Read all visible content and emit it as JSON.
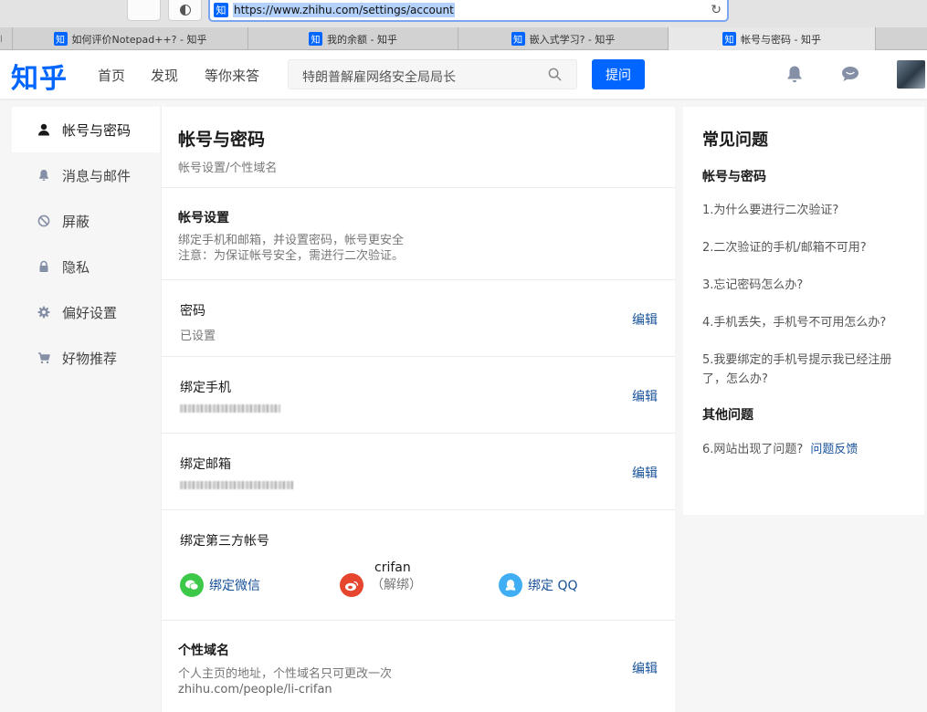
{
  "browser": {
    "url": "https://www.zhihu.com/settings/account",
    "favicon_char": "知",
    "reload_glyph": "↻",
    "tab_edge": "ꞁ",
    "tabs": [
      {
        "title": "如何评价Notepad++? - 知乎"
      },
      {
        "title": "我的余额 - 知乎"
      },
      {
        "title": "嵌入式学习? - 知乎"
      },
      {
        "title": "帐号与密码 - 知乎"
      }
    ]
  },
  "header": {
    "logo": "知乎",
    "nav": [
      "首页",
      "发现",
      "等你来答"
    ],
    "search_text": "特朗普解雇网络安全局局长",
    "ask_label": "提问"
  },
  "sidebar": {
    "items": [
      {
        "label": "帐号与密码",
        "icon": "user-icon"
      },
      {
        "label": "消息与邮件",
        "icon": "bell-icon"
      },
      {
        "label": "屏蔽",
        "icon": "block-icon"
      },
      {
        "label": "隐私",
        "icon": "lock-icon"
      },
      {
        "label": "偏好设置",
        "icon": "gear-icon"
      },
      {
        "label": "好物推荐",
        "icon": "cart-icon"
      }
    ]
  },
  "main": {
    "title": "帐号与密码",
    "subtitle": "帐号设置/个性域名",
    "account": {
      "title": "帐号设置",
      "line1": "绑定手机和邮箱，并设置密码，帐号更安全",
      "line2": "注意：为保证帐号安全，需进行二次验证。"
    },
    "edit_label": "编辑",
    "password": {
      "title": "密码",
      "value": "已设置"
    },
    "phone": {
      "title": "绑定手机"
    },
    "email": {
      "title": "绑定邮箱"
    },
    "third_party": {
      "title": "绑定第三方帐号",
      "wechat": "绑定微信",
      "weibo_name": "crifan",
      "weibo_unbind": "（解绑）",
      "qq": "绑定 QQ"
    },
    "domain": {
      "title": "个性域名",
      "desc": "个人主页的地址，个性域名只可更改一次",
      "url": "zhihu.com/people/li-crifan"
    }
  },
  "faq": {
    "title": "常见问题",
    "section1": "帐号与密码",
    "links": [
      "1.为什么要进行二次验证?",
      "2.二次验证的手机/邮箱不可用?",
      "3.忘记密码怎么办?",
      "4.手机丢失，手机号不可用怎么办?",
      "5.我要绑定的手机号提示我已经注册了，怎么办?"
    ],
    "section2": "其他问题",
    "other_link": "6.网站出现了问题?",
    "feedback": "问题反馈"
  },
  "colors": {
    "brand": "#0066ff",
    "link": "#175199",
    "wechat": "#3ec84a",
    "weibo": "#e6452e",
    "qq": "#40aef3"
  }
}
